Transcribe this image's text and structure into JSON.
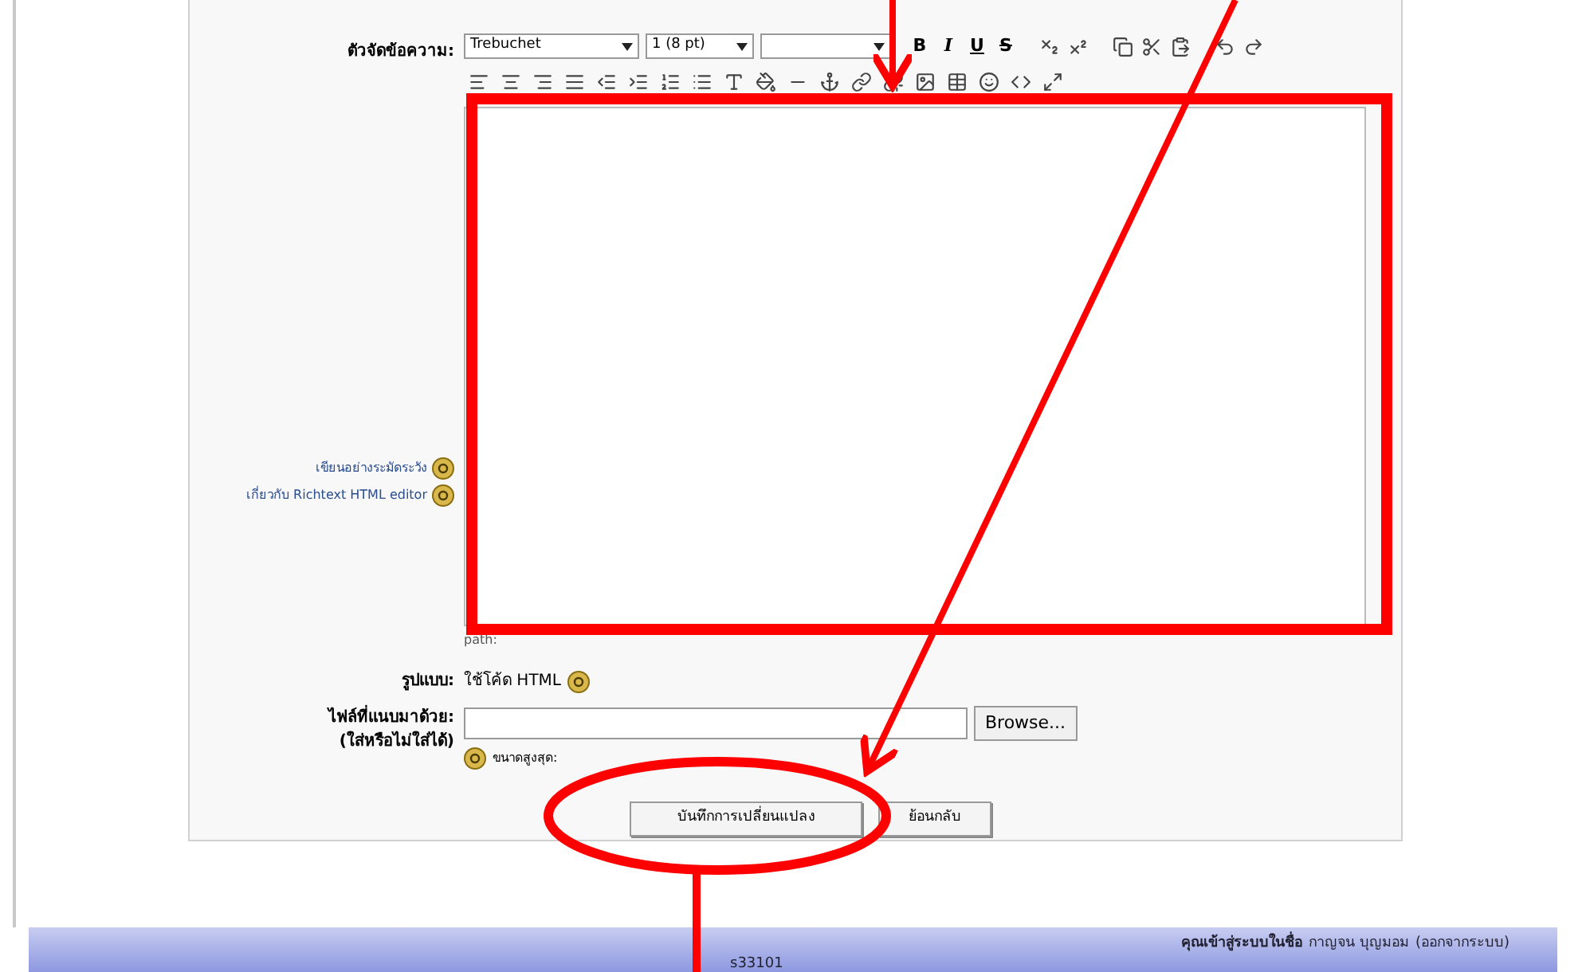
{
  "editor": {
    "label": "ตัวจัดข้อความ:",
    "font": "Trebuchet",
    "size": "1 (8 pt)",
    "format_buttons": [
      "B",
      "I",
      "U",
      "S"
    ],
    "path": "path:"
  },
  "help_links": [
    "เขียนอย่างระมัดระวัง",
    "เกี่ยวกับ Richtext HTML editor"
  ],
  "format": {
    "label": "รูปแบบ:",
    "value": "ใช้โค้ด HTML"
  },
  "attachment": {
    "label": "ไฟล์ที่แนบมาด้วย:",
    "note": "(ใส่หรือไม่ใส่ได้)",
    "button": "Browse...",
    "max_size": "ขนาดสูงสุด:"
  },
  "buttons": [
    "บันทึกการเปลี่ยนแปลง",
    "ย้อนกลับ"
  ],
  "footer": {
    "course": "s33101",
    "login": "คุณเข้าสู่ระบบในชื่อ",
    "user": "กาญจน บุญมอม",
    "logout": "(ออกจากระบบ)"
  }
}
